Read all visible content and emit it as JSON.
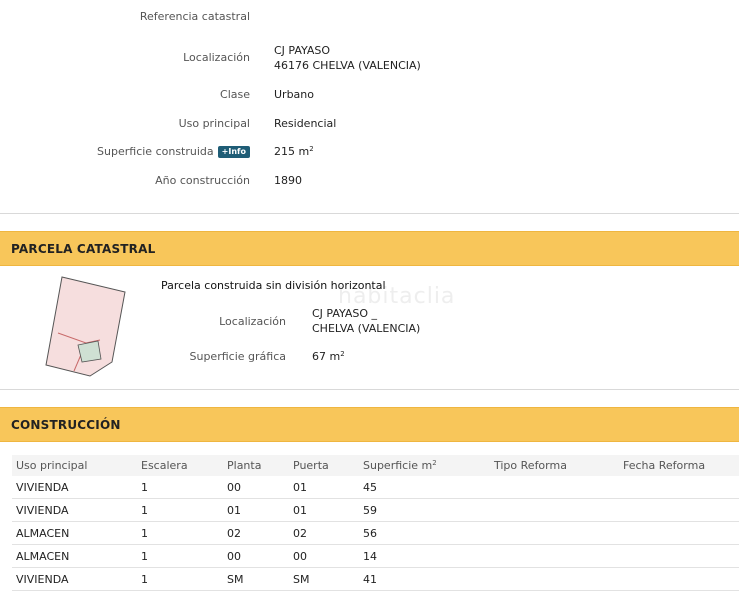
{
  "inmueble": {
    "referencia_label": "Referencia catastral",
    "localizacion_label": "Localización",
    "localizacion_line1": "CJ PAYASO",
    "localizacion_line2": "46176 CHELVA (VALENCIA)",
    "clase_label": "Clase",
    "clase_value": "Urbano",
    "uso_label": "Uso principal",
    "uso_value": "Residencial",
    "superficie_label": "Superficie construida",
    "info_badge": "+Info",
    "superficie_value": "215 m",
    "superficie_unit_exp": "2",
    "anio_label": "Año construcción",
    "anio_value": "1890"
  },
  "parcela": {
    "section_title": "PARCELA CATASTRAL",
    "heading": "Parcela construida sin división horizontal",
    "localizacion_label": "Localización",
    "localizacion_line1": "CJ PAYASO _",
    "localizacion_line2": "CHELVA (VALENCIA)",
    "superficie_label": "Superficie gráfica",
    "superficie_value": "67 m",
    "superficie_unit_exp": "2",
    "watermark": "habitaclia"
  },
  "construccion": {
    "section_title": "CONSTRUCCIÓN",
    "columns": {
      "uso": "Uso principal",
      "escalera": "Escalera",
      "planta": "Planta",
      "puerta": "Puerta",
      "superficie": "Superficie m",
      "superficie_exp": "2",
      "tipo_reforma": "Tipo Reforma",
      "fecha_reforma": "Fecha Reforma"
    },
    "rows": [
      {
        "uso": "VIVIENDA",
        "escalera": "1",
        "planta": "00",
        "puerta": "01",
        "superficie": "45"
      },
      {
        "uso": "VIVIENDA",
        "escalera": "1",
        "planta": "01",
        "puerta": "01",
        "superficie": "59"
      },
      {
        "uso": "ALMACEN",
        "escalera": "1",
        "planta": "02",
        "puerta": "02",
        "superficie": "56"
      },
      {
        "uso": "ALMACEN",
        "escalera": "1",
        "planta": "00",
        "puerta": "00",
        "superficie": "14"
      },
      {
        "uso": "VIVIENDA",
        "escalera": "1",
        "planta": "SM",
        "puerta": "SM",
        "superficie": "41"
      }
    ]
  },
  "colors": {
    "section_bar": "#f8c65a",
    "info_badge": "#1f5d76",
    "parcel_fill": "#f6dede",
    "parcel_selected": "#cfe0d3"
  }
}
